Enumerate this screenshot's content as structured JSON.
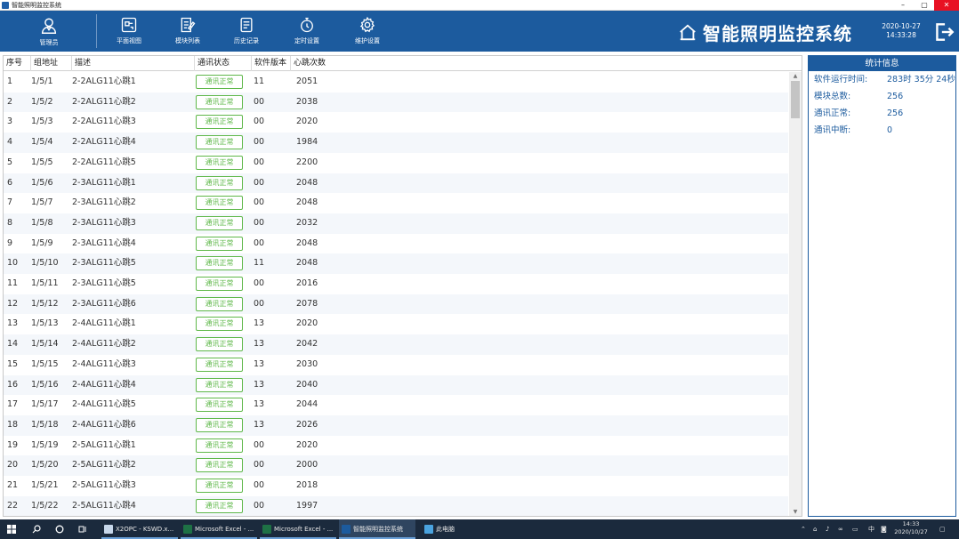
{
  "window": {
    "title": "智能照明监控系统",
    "minimize": "–",
    "maximize": "▢",
    "close": "✕"
  },
  "header": {
    "nav": [
      {
        "label": "管理员"
      },
      {
        "label": "平面视图"
      },
      {
        "label": "模块列表"
      },
      {
        "label": "历史记录"
      },
      {
        "label": "定时设置"
      },
      {
        "label": "维护设置"
      }
    ],
    "brand_title": "智能照明监控系统",
    "date": "2020-10-27",
    "time": "14:33:28"
  },
  "table": {
    "columns": [
      "序号",
      "组地址",
      "描述",
      "通讯状态",
      "软件版本",
      "心跳次数"
    ],
    "rows": [
      {
        "idx": "1",
        "addr": "1/5/1",
        "desc": "2-2ALG11心跳1",
        "status": "通讯正常",
        "ver": "11",
        "hb": "2051"
      },
      {
        "idx": "2",
        "addr": "1/5/2",
        "desc": "2-2ALG11心跳2",
        "status": "通讯正常",
        "ver": "00",
        "hb": "2038"
      },
      {
        "idx": "3",
        "addr": "1/5/3",
        "desc": "2-2ALG11心跳3",
        "status": "通讯正常",
        "ver": "00",
        "hb": "2020"
      },
      {
        "idx": "4",
        "addr": "1/5/4",
        "desc": "2-2ALG11心跳4",
        "status": "通讯正常",
        "ver": "00",
        "hb": "1984"
      },
      {
        "idx": "5",
        "addr": "1/5/5",
        "desc": "2-2ALG11心跳5",
        "status": "通讯正常",
        "ver": "00",
        "hb": "2200"
      },
      {
        "idx": "6",
        "addr": "1/5/6",
        "desc": "2-3ALG11心跳1",
        "status": "通讯正常",
        "ver": "00",
        "hb": "2048"
      },
      {
        "idx": "7",
        "addr": "1/5/7",
        "desc": "2-3ALG11心跳2",
        "status": "通讯正常",
        "ver": "00",
        "hb": "2048"
      },
      {
        "idx": "8",
        "addr": "1/5/8",
        "desc": "2-3ALG11心跳3",
        "status": "通讯正常",
        "ver": "00",
        "hb": "2032"
      },
      {
        "idx": "9",
        "addr": "1/5/9",
        "desc": "2-3ALG11心跳4",
        "status": "通讯正常",
        "ver": "00",
        "hb": "2048"
      },
      {
        "idx": "10",
        "addr": "1/5/10",
        "desc": "2-3ALG11心跳5",
        "status": "通讯正常",
        "ver": "11",
        "hb": "2048"
      },
      {
        "idx": "11",
        "addr": "1/5/11",
        "desc": "2-3ALG11心跳5",
        "status": "通讯正常",
        "ver": "00",
        "hb": "2016"
      },
      {
        "idx": "12",
        "addr": "1/5/12",
        "desc": "2-3ALG11心跳6",
        "status": "通讯正常",
        "ver": "00",
        "hb": "2078"
      },
      {
        "idx": "13",
        "addr": "1/5/13",
        "desc": "2-4ALG11心跳1",
        "status": "通讯正常",
        "ver": "13",
        "hb": "2020"
      },
      {
        "idx": "14",
        "addr": "1/5/14",
        "desc": "2-4ALG11心跳2",
        "status": "通讯正常",
        "ver": "13",
        "hb": "2042"
      },
      {
        "idx": "15",
        "addr": "1/5/15",
        "desc": "2-4ALG11心跳3",
        "status": "通讯正常",
        "ver": "13",
        "hb": "2030"
      },
      {
        "idx": "16",
        "addr": "1/5/16",
        "desc": "2-4ALG11心跳4",
        "status": "通讯正常",
        "ver": "13",
        "hb": "2040"
      },
      {
        "idx": "17",
        "addr": "1/5/17",
        "desc": "2-4ALG11心跳5",
        "status": "通讯正常",
        "ver": "13",
        "hb": "2044"
      },
      {
        "idx": "18",
        "addr": "1/5/18",
        "desc": "2-4ALG11心跳6",
        "status": "通讯正常",
        "ver": "13",
        "hb": "2026"
      },
      {
        "idx": "19",
        "addr": "1/5/19",
        "desc": "2-5ALG11心跳1",
        "status": "通讯正常",
        "ver": "00",
        "hb": "2020"
      },
      {
        "idx": "20",
        "addr": "1/5/20",
        "desc": "2-5ALG11心跳2",
        "status": "通讯正常",
        "ver": "00",
        "hb": "2000"
      },
      {
        "idx": "21",
        "addr": "1/5/21",
        "desc": "2-5ALG11心跳3",
        "status": "通讯正常",
        "ver": "00",
        "hb": "2018"
      },
      {
        "idx": "22",
        "addr": "1/5/22",
        "desc": "2-5ALG11心跳4",
        "status": "通讯正常",
        "ver": "00",
        "hb": "1997"
      }
    ]
  },
  "stats": {
    "title": "统计信息",
    "items": [
      {
        "key": "软件运行时间:",
        "value": "283时 35分 24秒"
      },
      {
        "key": "模块总数:",
        "value": "256"
      },
      {
        "key": "通讯正常:",
        "value": "256"
      },
      {
        "key": "通讯中断:",
        "value": "0"
      }
    ]
  },
  "taskbar": {
    "items": [
      {
        "label": "X2OPC - KSWD.x..."
      },
      {
        "label": "Microsoft Excel - ..."
      },
      {
        "label": "Microsoft Excel - ..."
      },
      {
        "label": "智能照明监控系统"
      },
      {
        "label": "此电脑"
      }
    ],
    "tray": {
      "lang": "中",
      "time": "14:33",
      "date": "2020/10/27"
    }
  },
  "colors": {
    "header": "#1c5b9e",
    "status_ok": "#5fb84a",
    "taskbar": "#1b2a3d"
  }
}
